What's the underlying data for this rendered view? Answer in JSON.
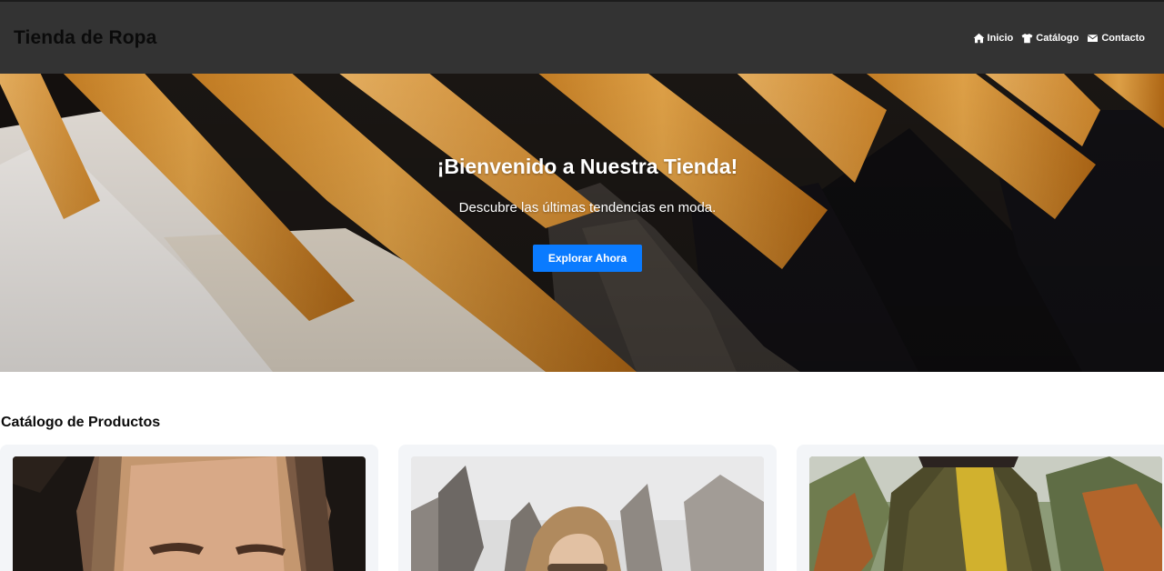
{
  "header": {
    "brand": "Tienda de Ropa",
    "nav": [
      {
        "label": "Inicio",
        "icon": "home-icon"
      },
      {
        "label": "Catálogo",
        "icon": "tshirt-icon"
      },
      {
        "label": "Contacto",
        "icon": "envelope-icon"
      }
    ]
  },
  "hero": {
    "title": "¡Bienvenido a Nuestra Tienda!",
    "subtitle": "Descubre las últimas tendencias en moda.",
    "button_label": "Explorar Ahora",
    "background": "clothing-on-wooden-hangers-photo"
  },
  "catalog": {
    "title": "Catálogo de Productos",
    "products": [
      {
        "image": "woman-with-headscarf-photo"
      },
      {
        "image": "woman-with-glasses-outdoors-photo"
      },
      {
        "image": "person-in-green-sweater-autumn-photo"
      }
    ]
  },
  "colors": {
    "header_bg": "#333333",
    "accent": "#0a7bff",
    "card_bg": "#f3f5f8"
  }
}
